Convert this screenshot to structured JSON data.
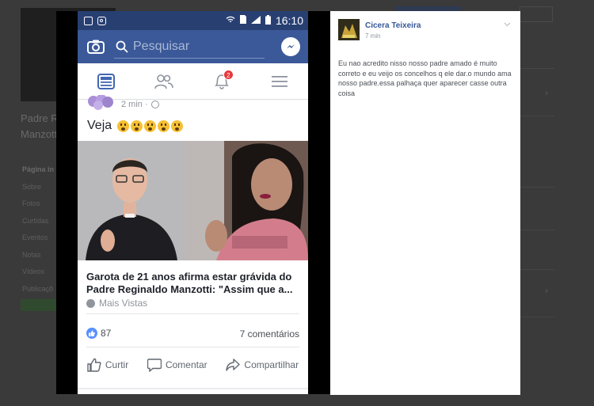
{
  "status_bar": {
    "time": "16:10"
  },
  "header": {
    "search_placeholder": "Pesquisar"
  },
  "tabs": {
    "notifications_badge": "2"
  },
  "post": {
    "time": "2 min ·",
    "text": "Veja",
    "link_title": "Garota de 21 anos afirma estar grávida do Padre Reginaldo Manzotti: \"Assim que a...",
    "source": "Mais Vistas",
    "likes": "87",
    "comments": "7 comentários",
    "actions": {
      "like": "Curtir",
      "comment": "Comentar",
      "share": "Compartilhar"
    }
  },
  "comment": {
    "author": "Cicera Teixeira",
    "time": "7 min",
    "text": "Eu nao acredito nisso nosso padre amado é muito correto e eu veijo os concelhos q ele dar.o mundo ama nosso padre.essa palhaça quer aparecer casse outra coisa"
  },
  "background_page": {
    "name": "Padre R Manzott",
    "menu": [
      "Página in",
      "Sobre",
      "Fotos",
      "Curtidas",
      "Eventos",
      "Notas",
      "Vídeos",
      "Publicaçõ"
    ]
  },
  "colors": {
    "fb_blue": "#3b5998",
    "status_bar": "#283f72",
    "link_blue": "#365899",
    "badge_red": "#e6393d"
  }
}
